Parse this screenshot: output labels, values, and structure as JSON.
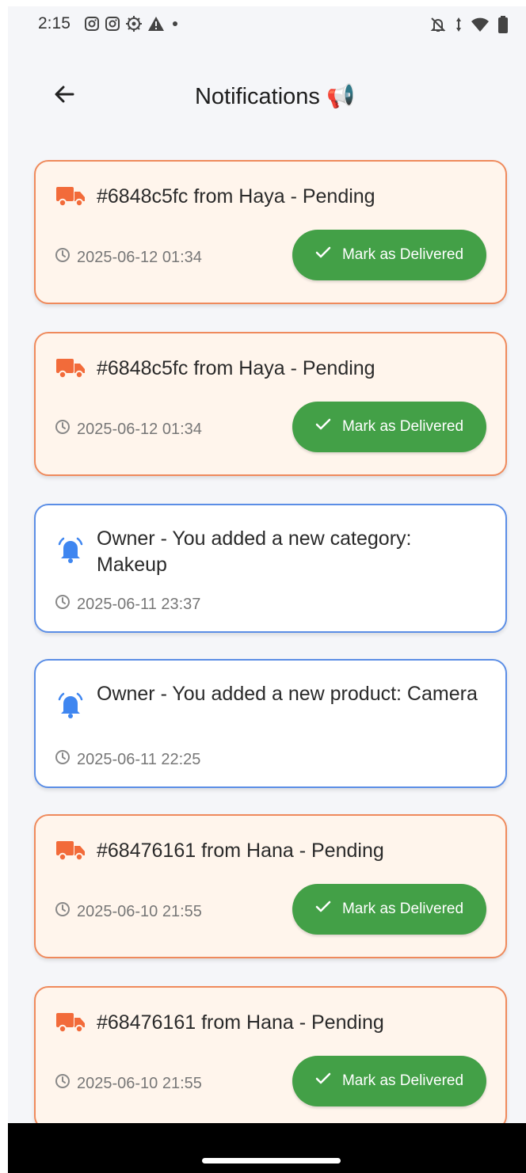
{
  "status_bar": {
    "time": "2:15",
    "left_icons": [
      "instagram-icon",
      "instagram-icon",
      "settings-icon",
      "warning-icon",
      "dot-icon"
    ],
    "right_icons": [
      "bell-off-icon",
      "data-arrows-icon",
      "wifi-icon",
      "battery-icon"
    ]
  },
  "header": {
    "title": "Notifications 📢",
    "back_icon": "arrow-left-icon"
  },
  "colors": {
    "order_bg": "#fff5ec",
    "order_border": "#ef8a5c",
    "order_icon": "#f26b3a",
    "info_border": "#5b8ee6",
    "info_icon": "#3f86f0",
    "button_green": "#43a047"
  },
  "notifications": [
    {
      "type": "order",
      "icon": "truck-icon",
      "title": "#6848c5fc from Haya - Pending",
      "time": "2025-06-12 01:34",
      "action_label": "Mark as Delivered"
    },
    {
      "type": "order",
      "icon": "truck-icon",
      "title": "#6848c5fc from Haya - Pending",
      "time": "2025-06-12 01:34",
      "action_label": "Mark as Delivered"
    },
    {
      "type": "info",
      "icon": "bell-icon",
      "title": "Owner - You added a new category: Makeup",
      "time": "2025-06-11 23:37"
    },
    {
      "type": "info",
      "icon": "bell-icon",
      "title": "Owner - You added a new product: Camera",
      "time": "2025-06-11 22:25"
    },
    {
      "type": "order",
      "icon": "truck-icon",
      "title": "#68476161 from Hana - Pending",
      "time": "2025-06-10 21:55",
      "action_label": "Mark as Delivered"
    },
    {
      "type": "order",
      "icon": "truck-icon",
      "title": "#68476161 from Hana - Pending",
      "time": "2025-06-10 21:55",
      "action_label": "Mark as Delivered"
    }
  ]
}
